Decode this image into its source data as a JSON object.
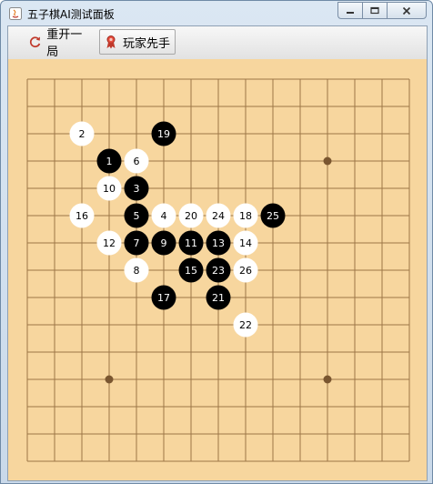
{
  "window": {
    "title": "五子棋AI测试面板",
    "controls": [
      "minimize-icon",
      "restore-icon",
      "close-icon"
    ]
  },
  "toolbar": {
    "restart_label": "重开一局",
    "restart_icon": "refresh-icon",
    "player_first_label": "玩家先手",
    "player_first_icon": "ribbon-icon"
  },
  "board": {
    "size": 15,
    "board_color": "#f7d69e",
    "line_color": "#9c7647",
    "star_color": "#7a5630",
    "star_points": [
      [
        11,
        3
      ],
      [
        3,
        11
      ],
      [
        11,
        11
      ]
    ],
    "stones": [
      {
        "n": 1,
        "col": 3,
        "row": 3,
        "color": "black"
      },
      {
        "n": 2,
        "col": 2,
        "row": 2,
        "color": "white"
      },
      {
        "n": 3,
        "col": 4,
        "row": 4,
        "color": "black"
      },
      {
        "n": 4,
        "col": 5,
        "row": 5,
        "color": "white"
      },
      {
        "n": 5,
        "col": 4,
        "row": 5,
        "color": "black"
      },
      {
        "n": 6,
        "col": 4,
        "row": 3,
        "color": "white"
      },
      {
        "n": 7,
        "col": 4,
        "row": 6,
        "color": "black"
      },
      {
        "n": 8,
        "col": 4,
        "row": 7,
        "color": "white"
      },
      {
        "n": 9,
        "col": 5,
        "row": 6,
        "color": "black"
      },
      {
        "n": 10,
        "col": 3,
        "row": 4,
        "color": "white"
      },
      {
        "n": 11,
        "col": 6,
        "row": 6,
        "color": "black"
      },
      {
        "n": 12,
        "col": 3,
        "row": 6,
        "color": "white"
      },
      {
        "n": 13,
        "col": 7,
        "row": 6,
        "color": "black"
      },
      {
        "n": 14,
        "col": 8,
        "row": 6,
        "color": "white"
      },
      {
        "n": 15,
        "col": 6,
        "row": 7,
        "color": "black"
      },
      {
        "n": 16,
        "col": 2,
        "row": 5,
        "color": "white"
      },
      {
        "n": 17,
        "col": 5,
        "row": 8,
        "color": "black"
      },
      {
        "n": 18,
        "col": 8,
        "row": 5,
        "color": "white"
      },
      {
        "n": 19,
        "col": 5,
        "row": 2,
        "color": "black"
      },
      {
        "n": 20,
        "col": 6,
        "row": 5,
        "color": "white"
      },
      {
        "n": 21,
        "col": 7,
        "row": 8,
        "color": "black"
      },
      {
        "n": 22,
        "col": 8,
        "row": 9,
        "color": "white"
      },
      {
        "n": 23,
        "col": 7,
        "row": 7,
        "color": "black"
      },
      {
        "n": 24,
        "col": 7,
        "row": 5,
        "color": "white"
      },
      {
        "n": 25,
        "col": 9,
        "row": 5,
        "color": "black"
      },
      {
        "n": 26,
        "col": 8,
        "row": 7,
        "color": "white"
      }
    ]
  }
}
